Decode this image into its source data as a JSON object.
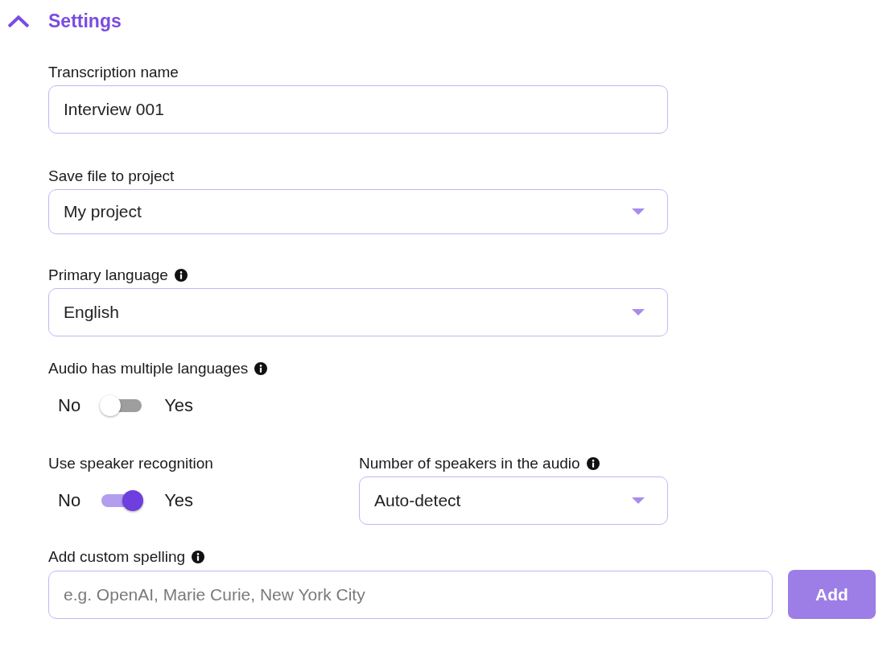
{
  "section": {
    "title": "Settings",
    "expanded": true
  },
  "rows": [
    {
      "fields": [
        {
          "kind": "text",
          "label": "Transcription name",
          "info": false,
          "value": "Interview 001"
        }
      ]
    },
    {
      "fields": [
        {
          "kind": "select",
          "label": "Save file to project",
          "info": false,
          "value": "My project"
        }
      ]
    },
    {
      "fields": [
        {
          "kind": "select",
          "label": "Primary language",
          "info": true,
          "value": "English"
        }
      ]
    },
    {
      "fields": [
        {
          "kind": "toggle",
          "label": "Audio has multiple languages",
          "info": true,
          "off_label": "No",
          "on_label": "Yes",
          "on": false
        }
      ]
    },
    {
      "fields": [
        {
          "kind": "toggle",
          "label": "Use speaker recognition",
          "info": false,
          "off_label": "No",
          "on_label": "Yes",
          "on": true
        },
        {
          "kind": "select",
          "label": "Number of speakers in the audio",
          "info": true,
          "value": "Auto-detect"
        }
      ]
    },
    {
      "fields": [
        {
          "kind": "text_button",
          "label": "Add custom spelling",
          "info": true,
          "placeholder": "e.g. OpenAI, Marie Curie, New York City",
          "button": "Add"
        }
      ]
    }
  ]
}
